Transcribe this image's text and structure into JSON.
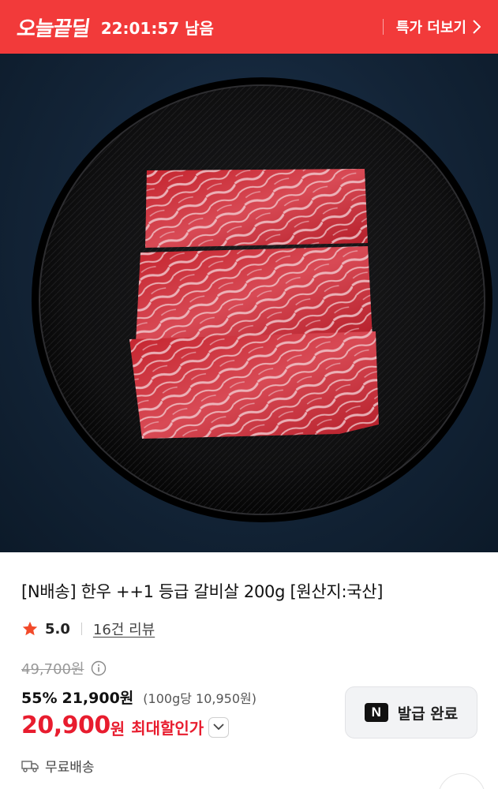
{
  "deal_bar": {
    "logo_text": "오늘끝딜",
    "timer": "22:01:57 남음",
    "more_label": "특가 더보기",
    "bg_color": "#f23a3a"
  },
  "product": {
    "image_alt": "한우 갈비살 on black plate",
    "title": "[N배송] 한우 ++1 등급 갈비살 200g [원산지:국산]",
    "rating": "5.0",
    "review_count": "16건 리뷰",
    "original_price": "49,700원",
    "discount_rate": "55%",
    "sale_price": "21,900원",
    "unit_price": "(100g당 10,950원)",
    "max_discount_price": "20,900",
    "max_discount_won": "원",
    "max_discount_label": "최대할인가",
    "coupon_badge": "N",
    "coupon_label": "발급 완료",
    "shipping": "무료배송",
    "accent_color": "#e81c2e"
  },
  "icons": {
    "star": "star-icon",
    "info": "info-icon",
    "chevron_right": "chevron-right-icon",
    "chevron_down": "chevron-down-icon",
    "truck": "truck-icon"
  }
}
